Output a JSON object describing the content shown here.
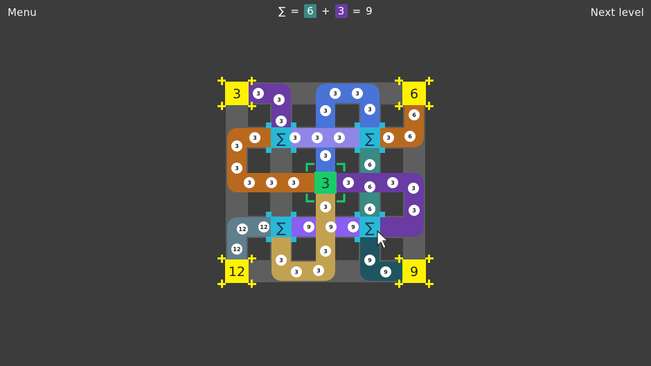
{
  "topbar": {
    "menu_label": "Menu",
    "next_label": "Next level",
    "formula": {
      "sigma": "∑",
      "eq1": "=",
      "a": "6",
      "plus": "+",
      "b": "3",
      "eq2": "=",
      "result": "9",
      "a_color": "#3a8a84",
      "b_color": "#6a3ba2"
    }
  },
  "board": {
    "corners": [
      "3",
      "6",
      "12",
      "9"
    ],
    "sum_symbol": "∑",
    "center_value": "3",
    "colors": {
      "background": "#3c3c3c",
      "grid": "#5e5e5e",
      "corner": "#fff200",
      "sum_node": "#29b8d6",
      "center_node": "#19cc6a",
      "center_bracket": "#19cc6a",
      "pipe_purple_dark": "#6a3ba2",
      "pipe_blue": "#4a73d8",
      "pipe_orange": "#b8691e",
      "pipe_lavender": "#8f86e8",
      "pipe_violet": "#8a5ef0",
      "pipe_teal": "#3a8a84",
      "pipe_slate": "#5f7f8c",
      "pipe_gold": "#c2a250",
      "pipe_dark_teal": "#1f5560"
    },
    "badges": {
      "purple_top": [
        "3",
        "3",
        "3"
      ],
      "blue_top": [
        "3",
        "3",
        "3",
        "3",
        "3",
        "3"
      ],
      "orange_left": [
        "3",
        "3",
        "3",
        "3",
        "3",
        "3"
      ],
      "orange_right": [
        "6",
        "6"
      ],
      "lavender_row": [
        "3",
        "3",
        "3"
      ],
      "teal_column": [
        "6",
        "6",
        "6"
      ],
      "purple_right": [
        "3",
        "3",
        "3",
        "3"
      ],
      "violet_row": [
        "9",
        "9",
        "9"
      ],
      "slate_left": [
        "12",
        "12",
        "12"
      ],
      "gold_bottom": [
        "3",
        "3",
        "3",
        "3",
        "3"
      ],
      "dark_teal_bottom": [
        "9",
        "9"
      ]
    }
  }
}
